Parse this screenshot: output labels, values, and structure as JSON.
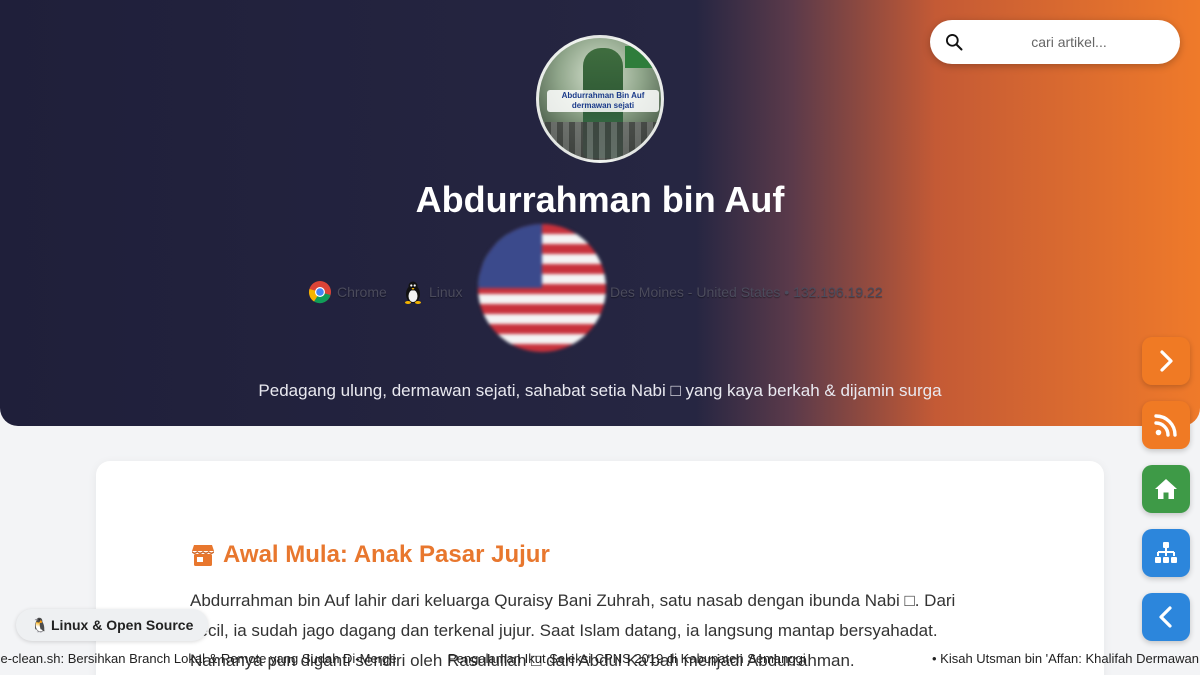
{
  "search": {
    "placeholder": "cari artikel..."
  },
  "hero": {
    "avatar_caption_line1": "Abdurrahman Bin Auf",
    "avatar_caption_line2": "dermawan sejati",
    "title": "Abdurrahman bin Auf",
    "visitor": {
      "browser": "Chrome",
      "os": "Linux",
      "location": "Des Moines - United States • 132.196.19.22"
    },
    "tagline": "Pedagang ulung, dermawan sejati, sahabat setia Nabi □ yang kaya berkah & dijamin surga"
  },
  "article": {
    "heading": "Awal Mula: Anak Pasar Jujur",
    "paragraph": "Abdurrahman bin Auf lahir dari keluarga Quraisy Bani Zuhrah, satu nasab dengan ibunda Nabi □. Dari kecil, ia sudah jago dagang dan terkenal jujur. Saat Islam datang, ia langsung mantap bersyahadat. Namanya pun diganti sendiri oleh Rasulullah □ dari Abdul Ka'bah menjadi Abdurrahman."
  },
  "side_nav": {
    "icons": [
      "chevron-right-icon",
      "rss-icon",
      "home-icon",
      "sitemap-icon",
      "chevron-left-icon"
    ],
    "colors": {
      "orange": "#f07a24",
      "green": "#3e9a47",
      "blue": "#2c86dc"
    }
  },
  "topic_pill": {
    "icon": "🐧",
    "label": "Linux & Open Source"
  },
  "ticker": {
    "items": [
      "ce-clean.sh: Bersihkan Branch Lokal & Remote yang Sudah Di-Merge",
      "Pengalaman Ikut Seleksi CPNS 2019 di Kabupaten Semanggi",
      "• Kisah Utsman bin 'Affan: Khalifah Dermawan"
    ]
  },
  "colors": {
    "hero_dark": "#262642",
    "hero_orange": "#ef7a2a",
    "heading_orange": "#e8772e"
  }
}
